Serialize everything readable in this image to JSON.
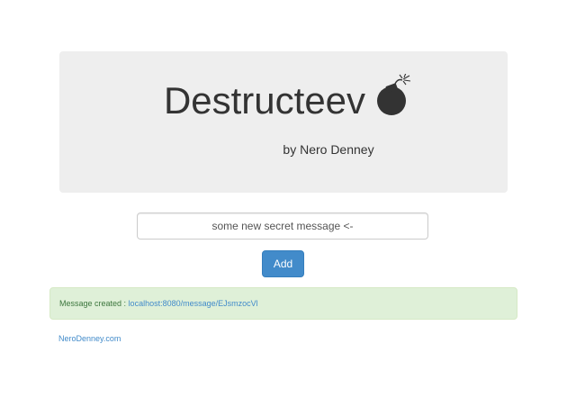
{
  "header": {
    "title": "Destructeev",
    "byline": "by Nero Denney",
    "logo_icon": "bomb-icon"
  },
  "form": {
    "message_value": "some new secret message <-",
    "add_label": "Add"
  },
  "alert": {
    "prefix": "Message created :",
    "link_text": "localhost:8080/message/EJsmzocVl"
  },
  "footer": {
    "link_text": "NeroDenney.com"
  },
  "colors": {
    "primary": "#428bca",
    "success_bg": "#dff0d8",
    "success_text": "#3c763d",
    "jumbotron_bg": "#eeeeee"
  }
}
